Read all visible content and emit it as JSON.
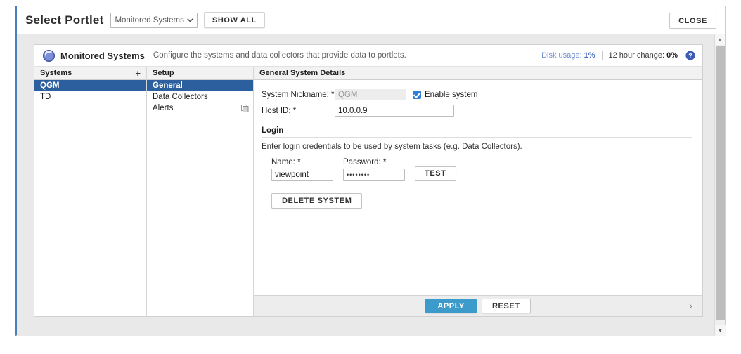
{
  "topbar": {
    "title": "Select Portlet",
    "portlet_select_value": "Monitored Systems",
    "chevron": "⌄",
    "show_all_label": "SHOW ALL",
    "close_label": "CLOSE"
  },
  "portlet": {
    "name": "Monitored Systems",
    "description": "Configure the systems and data collectors that provide data to portlets.",
    "disk_usage_label": "Disk usage:",
    "disk_usage_value": "1%",
    "hour_change_label": "12 hour change:",
    "hour_change_value": "0%",
    "help_glyph": "?",
    "accent_blue": "#2c5f9e",
    "link_blue": "#4a6fc4",
    "apply_blue": "#3d9bcb"
  },
  "systems_panel": {
    "header": "Systems",
    "add_label": "+",
    "items": [
      {
        "label": "QGM",
        "selected": true
      },
      {
        "label": "TD",
        "selected": false
      }
    ]
  },
  "setup_panel": {
    "header": "Setup",
    "items": [
      {
        "label": "General",
        "selected": true,
        "icon": false
      },
      {
        "label": "Data Collectors",
        "selected": false,
        "icon": false
      },
      {
        "label": "Alerts",
        "selected": false,
        "icon": true
      }
    ]
  },
  "details": {
    "header": "General System Details",
    "nickname_label": "System Nickname: *",
    "nickname_value": "QGM",
    "enable_system_label": "Enable system",
    "enable_system_checked": true,
    "host_label": "Host ID: *",
    "host_value": "10.0.0.9",
    "login_title": "Login",
    "login_desc": "Enter login credentials to be used by system tasks (e.g. Data Collectors).",
    "name_label": "Name: *",
    "name_value": "viewpoint",
    "password_label": "Password: *",
    "password_value": "••••••••",
    "test_label": "TEST",
    "delete_label": "DELETE SYSTEM"
  },
  "footer": {
    "apply_label": "APPLY",
    "reset_label": "RESET",
    "next_glyph": "›"
  },
  "scrollbar": {
    "up_glyph": "▲",
    "down_glyph": "▼"
  }
}
